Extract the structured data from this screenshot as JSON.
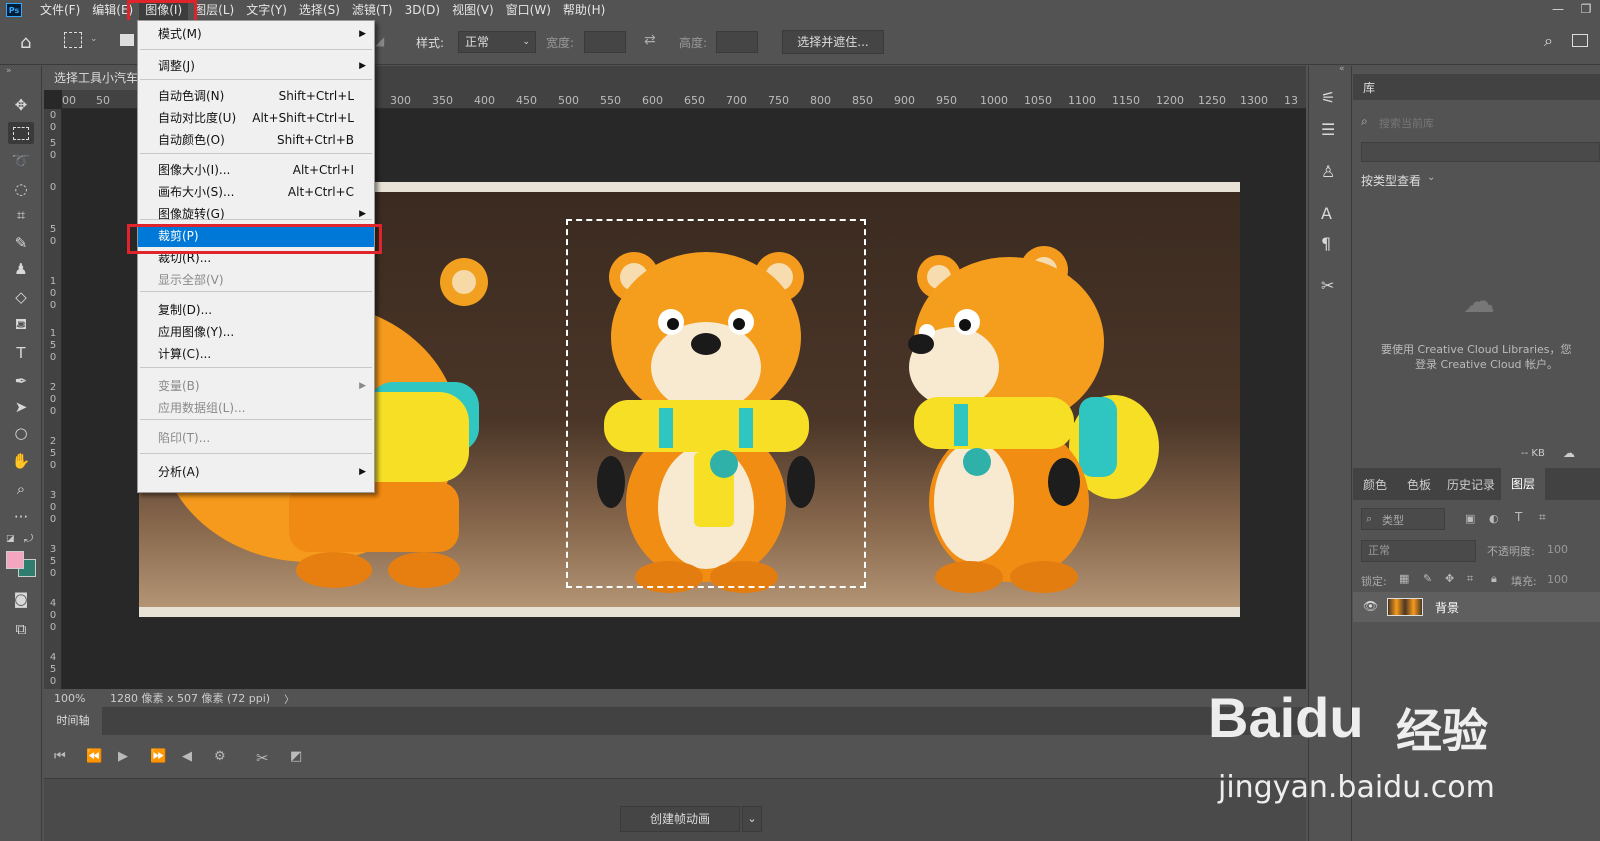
{
  "app": {
    "logo": "Ps"
  },
  "menubar": [
    "文件(F)",
    "编辑(E)",
    "图像(I)",
    "图层(L)",
    "文字(Y)",
    "选择(S)",
    "滤镜(T)",
    "3D(D)",
    "视图(V)",
    "窗口(W)",
    "帮助(H)"
  ],
  "options": {
    "style_label": "样式:",
    "style_value": "正常",
    "width_label": "宽度:",
    "height_label": "高度:",
    "select_mask": "选择并遮住..."
  },
  "document": {
    "tab_title": "选择工具小汽车",
    "ruler_x": [
      "00",
      "50",
      "300",
      "350",
      "400",
      "450",
      "500",
      "550",
      "600",
      "650",
      "700",
      "750",
      "800",
      "850",
      "900",
      "950",
      "1000",
      "1050",
      "1100",
      "1150",
      "1200",
      "1250",
      "1300",
      "13"
    ],
    "zoom": "100%",
    "size_info": "1280 像素 x 507 像素 (72 ppi)",
    "status_arrow": "〉"
  },
  "image_menu": {
    "items": [
      {
        "label": "模式(M)",
        "shortcut": "",
        "submenu": true,
        "disabled": false
      },
      {
        "label": "调整(J)",
        "shortcut": "",
        "submenu": true,
        "disabled": false
      },
      {
        "label": "自动色调(N)",
        "shortcut": "Shift+Ctrl+L",
        "submenu": false,
        "disabled": false
      },
      {
        "label": "自动对比度(U)",
        "shortcut": "Alt+Shift+Ctrl+L",
        "submenu": false,
        "disabled": false
      },
      {
        "label": "自动颜色(O)",
        "shortcut": "Shift+Ctrl+B",
        "submenu": false,
        "disabled": false
      },
      {
        "label": "图像大小(I)...",
        "shortcut": "Alt+Ctrl+I",
        "submenu": false,
        "disabled": false
      },
      {
        "label": "画布大小(S)...",
        "shortcut": "Alt+Ctrl+C",
        "submenu": false,
        "disabled": false
      },
      {
        "label": "图像旋转(G)",
        "shortcut": "",
        "submenu": true,
        "disabled": false
      },
      {
        "label": "裁剪(P)",
        "shortcut": "",
        "submenu": false,
        "disabled": false,
        "highlighted": true
      },
      {
        "label": "裁切(R)...",
        "shortcut": "",
        "submenu": false,
        "disabled": false
      },
      {
        "label": "显示全部(V)",
        "shortcut": "",
        "submenu": false,
        "disabled": true
      },
      {
        "label": "复制(D)...",
        "shortcut": "",
        "submenu": false,
        "disabled": false
      },
      {
        "label": "应用图像(Y)...",
        "shortcut": "",
        "submenu": false,
        "disabled": false
      },
      {
        "label": "计算(C)...",
        "shortcut": "",
        "submenu": false,
        "disabled": false
      },
      {
        "label": "变量(B)",
        "shortcut": "",
        "submenu": true,
        "disabled": true
      },
      {
        "label": "应用数据组(L)...",
        "shortcut": "",
        "submenu": false,
        "disabled": true
      },
      {
        "label": "陷印(T)...",
        "shortcut": "",
        "submenu": false,
        "disabled": true
      },
      {
        "label": "分析(A)",
        "shortcut": "",
        "submenu": true,
        "disabled": false
      }
    ]
  },
  "timeline": {
    "title": "时间轴",
    "create_button": "创建帧动画"
  },
  "library": {
    "title": "库",
    "search_placeholder": "搜索当前库",
    "view_by": "按类型查看",
    "cc_message_1": "要使用 Creative Cloud Libraries，您",
    "cc_message_2": "登录 Creative Cloud 帐户。",
    "size": "-- KB"
  },
  "layers_panel": {
    "tabs": [
      "颜色",
      "色板",
      "历史记录",
      "图层"
    ],
    "active_tab": "图层",
    "filter_label": "类型",
    "blend_mode": "正常",
    "opacity_label": "不透明度:",
    "opacity_value": "100",
    "lock_label": "锁定:",
    "fill_label": "填充:",
    "fill_value": "100",
    "layer_name": "背景"
  },
  "watermark": {
    "brand": "Baidu",
    "brand_cn": "经验",
    "url": "jingyan.baidu.com"
  },
  "colors": {
    "menu_highlight": "#0078d7",
    "annotation_red": "#e0242c",
    "foreground": "#f4a6c0",
    "background": "#2f7d6e"
  }
}
